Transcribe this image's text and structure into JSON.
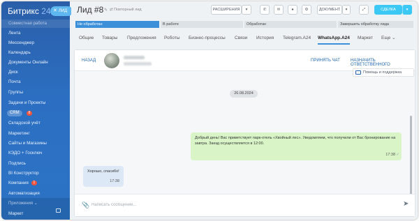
{
  "sidebar": {
    "logo_name": "Битрикс",
    "logo_num": "24",
    "section_title": "Совместная работа",
    "items": [
      {
        "label": "Лента"
      },
      {
        "label": "Мессенджер"
      },
      {
        "label": "Календарь"
      },
      {
        "label": "Документы Онлайн"
      },
      {
        "label": "Диск"
      },
      {
        "label": "Почта"
      },
      {
        "label": "Группы"
      },
      {
        "label": "Задачи и Проекты"
      },
      {
        "label": "CRM",
        "badge": "8"
      },
      {
        "label": "Складской учёт"
      },
      {
        "label": "Маркетинг"
      },
      {
        "label": "Сайты и Магазины"
      },
      {
        "label": "КЭДО + Госключ"
      },
      {
        "label": "Подпись"
      },
      {
        "label": "BI Конструктор"
      },
      {
        "label": "Компания",
        "badge": "1"
      },
      {
        "label": "Автоматизация"
      }
    ],
    "apps_section": "Приложения",
    "market": "Маркет"
  },
  "close_tab": {
    "icon": "close-icon",
    "label": "ЛИД"
  },
  "header": {
    "title": "Лид #8",
    "edit_icon": "pencil-icon",
    "subtitle": "Повторный лид",
    "buttons": {
      "extensions": "РАСШИРЕНИЯ",
      "document": "ДОКУМЕНТ",
      "save": "СДЕЛКА"
    }
  },
  "stages": [
    {
      "label": "Не обработан",
      "active": true
    },
    {
      "label": "В работе",
      "active": false
    },
    {
      "label": "Обработан",
      "active": false
    },
    {
      "label": "Завершить обработку лида",
      "active": false
    }
  ],
  "tabs": [
    "Общие",
    "Товары",
    "Предложения",
    "Роботы",
    "Бизнес-процессы",
    "Связи",
    "История",
    "Telegram.A24",
    "WhatsApp.A24",
    "Маркет",
    "Еще"
  ],
  "active_tab": "WhatsApp.A24",
  "chat": {
    "back": "НАЗАД",
    "accept": "ПРИНЯТЬ ЧАТ",
    "assign": "НАЗНАЧИТЬ ОТВЕТСТВЕННОГО",
    "help": "Помощь и поддержка",
    "date": "26.08.2024",
    "messages": [
      {
        "direction": "out",
        "text": "Добрый день! Вас приветствует парк-отель «Хвойный лес». Уведомляем, что получили от Вас бронирование на завтра. Заезд осуществляется в 12:00.",
        "time": "17:38"
      },
      {
        "direction": "in",
        "text": "Хорошо, спасибо!",
        "time": "17:38"
      }
    ],
    "composer_placeholder": "Написать сообщение...",
    "attach_icon": "paperclip-icon",
    "send_icon": "send-icon"
  },
  "colors": {
    "sidebar": "#2c6fc2",
    "accent": "#3bc8f5",
    "stage_active": "#3c8fd9",
    "outgoing_bubble": "#d9f5c7",
    "incoming_bubble": "#dde8f6"
  }
}
